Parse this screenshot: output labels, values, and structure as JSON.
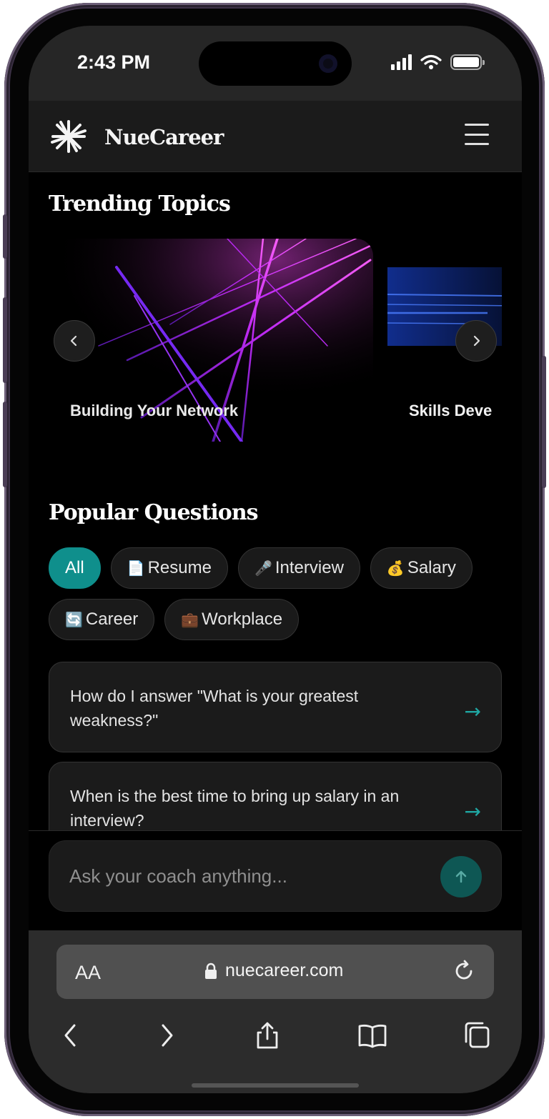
{
  "status": {
    "time": "2:43 PM"
  },
  "header": {
    "brand": "NueCareer"
  },
  "trending": {
    "title": "Trending Topics",
    "cards": [
      {
        "title": "Building Your Network"
      },
      {
        "title": "Skills Deve"
      }
    ]
  },
  "popular": {
    "title": "Popular Questions",
    "filters": [
      {
        "label": "All",
        "icon": "",
        "active": true
      },
      {
        "label": "Resume",
        "icon": "📄",
        "active": false
      },
      {
        "label": "Interview",
        "icon": "🎤",
        "active": false
      },
      {
        "label": "Salary",
        "icon": "💰",
        "active": false
      },
      {
        "label": "Career",
        "icon": "🔄",
        "active": false
      },
      {
        "label": "Workplace",
        "icon": "💼",
        "active": false
      }
    ],
    "questions": [
      {
        "text": "How do I answer \"What is your greatest weakness?\""
      },
      {
        "text": "When is the best time to bring up salary in an interview?"
      }
    ]
  },
  "composer": {
    "placeholder": "Ask your coach anything..."
  },
  "browser": {
    "aa": "AA",
    "url": "nuecareer.com"
  },
  "colors": {
    "accent": "#0f8f8c",
    "accent_dark": "#0e5754",
    "arrow": "#1fa7a3",
    "background": "#000000"
  }
}
